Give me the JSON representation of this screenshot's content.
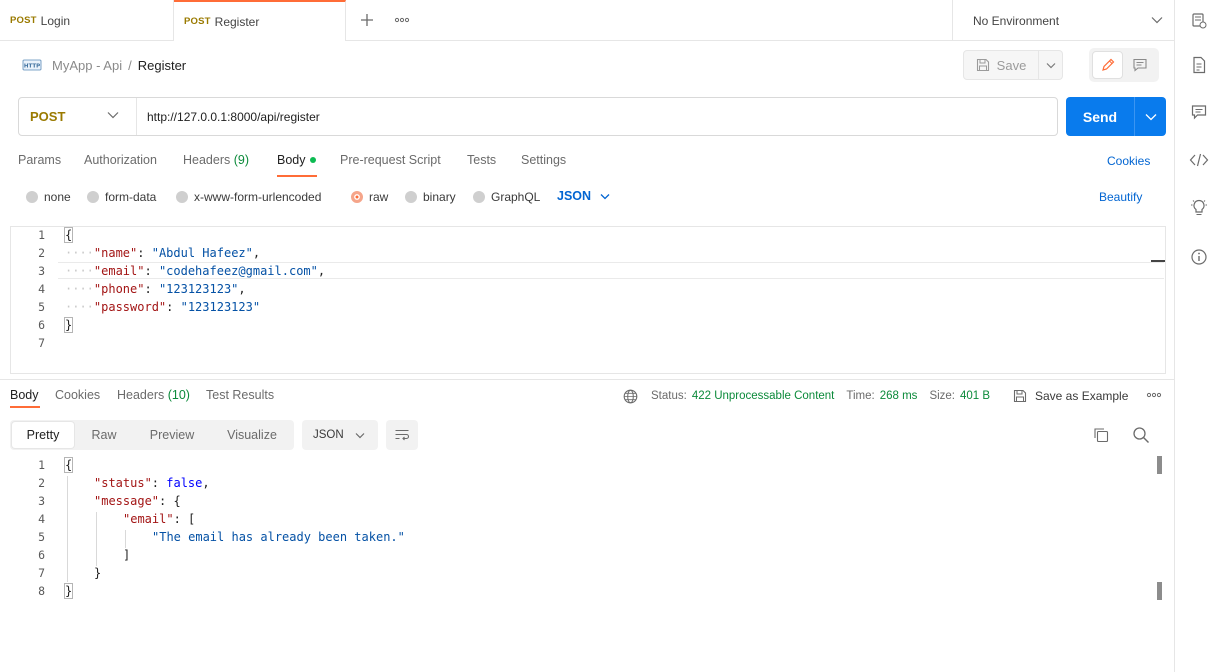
{
  "tabs": [
    {
      "method": "POST",
      "label": "Login",
      "active": false
    },
    {
      "method": "POST",
      "label": "Register",
      "active": true
    }
  ],
  "tab_actions": {
    "add": "+",
    "more": "ooo"
  },
  "environment": {
    "label": "No Environment"
  },
  "right_sidebar": [
    "api-icon",
    "docs-icon",
    "comments-icon",
    "code-icon",
    "lightbulb-icon",
    "info-icon"
  ],
  "breadcrumb": {
    "collection": "MyApp - Api",
    "separator": "/",
    "request": "Register"
  },
  "toolbar": {
    "save_label": "Save"
  },
  "request": {
    "method": "POST",
    "url": "http://127.0.0.1:8000/api/register",
    "send_label": "Send"
  },
  "request_tabs": [
    {
      "label": "Params"
    },
    {
      "label": "Authorization"
    },
    {
      "label": "Headers",
      "count": "(9)"
    },
    {
      "label": "Body",
      "active": true
    },
    {
      "label": "Pre-request Script"
    },
    {
      "label": "Tests"
    },
    {
      "label": "Settings"
    }
  ],
  "cookies_label": "Cookies",
  "body_types": [
    "none",
    "form-data",
    "x-www-form-urlencoded",
    "raw",
    "binary",
    "GraphQL"
  ],
  "body_type_selected": "raw",
  "body_format": "JSON",
  "beautify_label": "Beautify",
  "request_body": {
    "line_numbers": [
      "1",
      "2",
      "3",
      "4",
      "5",
      "6",
      "7"
    ],
    "open": "{",
    "fields": [
      {
        "key": "\"name\"",
        "value": "\"Abdul Hafeez\"",
        "comma": ","
      },
      {
        "key": "\"email\"",
        "value": "\"codehafeez@gmail.com\"",
        "comma": ","
      },
      {
        "key": "\"phone\"",
        "value": "\"123123123\"",
        "comma": ","
      },
      {
        "key": "\"password\"",
        "value": "\"123123123\"",
        "comma": ""
      }
    ],
    "close": "}"
  },
  "response_tabs": [
    {
      "label": "Body",
      "active": true
    },
    {
      "label": "Cookies"
    },
    {
      "label": "Headers",
      "count": "(10)"
    },
    {
      "label": "Test Results"
    }
  ],
  "response_meta": {
    "status_label": "Status:",
    "status_value": "422 Unprocessable Content",
    "time_label": "Time:",
    "time_value": "268 ms",
    "size_label": "Size:",
    "size_value": "401 B",
    "save_example": "Save as Example"
  },
  "response_views": [
    "Pretty",
    "Raw",
    "Preview",
    "Visualize"
  ],
  "response_view_active": "Pretty",
  "response_format": "JSON",
  "response_body": {
    "line_numbers": [
      "1",
      "2",
      "3",
      "4",
      "5",
      "6",
      "7",
      "8"
    ],
    "l1": "{",
    "status_key": "\"status\"",
    "status_val": "false",
    "message_key": "\"message\"",
    "email_key": "\"email\"",
    "email_msg": "\"The email has already been taken.\"",
    "close_arr": "]",
    "close_obj": "}",
    "close_root": "}"
  },
  "colors": {
    "accent": "#ff6c37",
    "send": "#097bed",
    "link": "#0265d2",
    "status_ok": "#0b8a3a",
    "method": "#9a7a00"
  }
}
